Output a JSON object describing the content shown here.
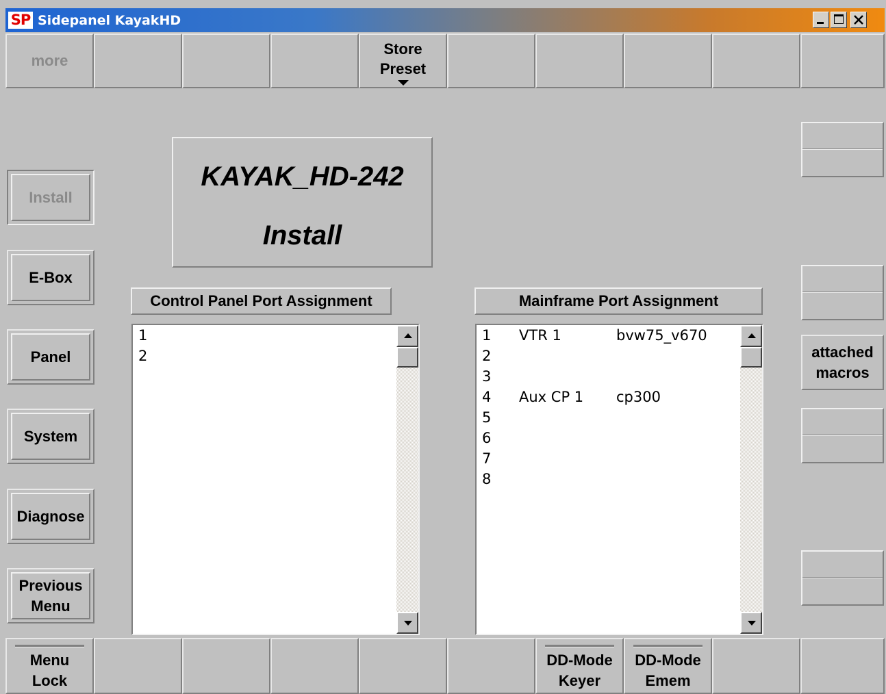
{
  "window": {
    "logo": "SP",
    "title": "Sidepanel KayakHD",
    "controls": [
      "minimize-icon",
      "maximize-icon",
      "close-icon"
    ]
  },
  "top_bar": {
    "more_label": "more",
    "store_preset_line1": "Store",
    "store_preset_line2": "Preset"
  },
  "left_menu": {
    "install": "Install",
    "ebox": "E-Box",
    "panel": "Panel",
    "system": "System",
    "diagnose": "Diagnose",
    "previous_line1": "Previous",
    "previous_line2": "Menu"
  },
  "title_box": {
    "line1": "KAYAK_HD-242",
    "line2": "Install"
  },
  "control_panel": {
    "header": "Control Panel Port Assignment",
    "rows": [
      {
        "num": "1"
      },
      {
        "num": "2"
      }
    ]
  },
  "mainframe": {
    "header": "Mainframe Port Assignment",
    "rows": [
      {
        "num": "1",
        "device": "VTR 1",
        "driver": "bvw75_v670"
      },
      {
        "num": "2",
        "device": "",
        "driver": ""
      },
      {
        "num": "3",
        "device": "",
        "driver": ""
      },
      {
        "num": "4",
        "device": "Aux CP 1",
        "driver": "cp300"
      },
      {
        "num": "5",
        "device": "",
        "driver": ""
      },
      {
        "num": "6",
        "device": "",
        "driver": ""
      },
      {
        "num": "7",
        "device": "",
        "driver": ""
      },
      {
        "num": "8",
        "device": "",
        "driver": ""
      }
    ]
  },
  "right_panel": {
    "attached_line1": "attached",
    "attached_line2": "macros"
  },
  "bottom_bar": {
    "menu_lock_line1": "Menu",
    "menu_lock_line2": "Lock",
    "dd_keyer_line1": "DD-Mode",
    "dd_keyer_line2": "Keyer",
    "dd_emem_line1": "DD-Mode",
    "dd_emem_line2": "Emem"
  }
}
